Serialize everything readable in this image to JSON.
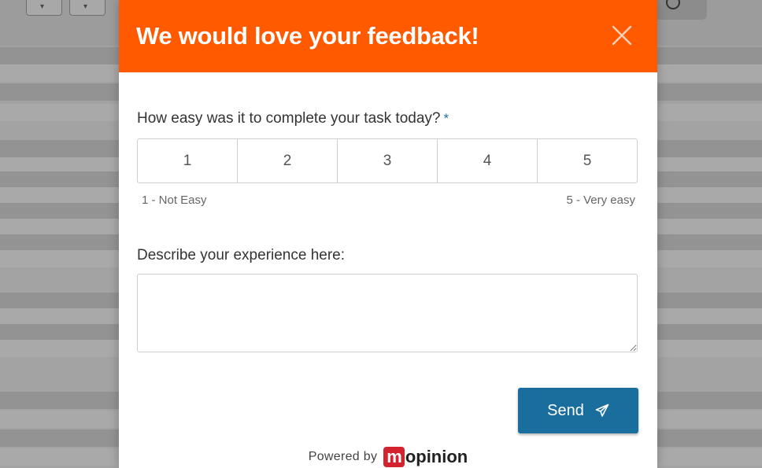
{
  "modal": {
    "title": "We would love your feedback!",
    "close_icon": "close-icon",
    "question": "How easy was it to complete your task today?",
    "required_marker": "*",
    "rating_options": [
      "1",
      "2",
      "3",
      "4",
      "5"
    ],
    "scale_low_label": "1 - Not Easy",
    "scale_high_label": "5 - Very easy",
    "experience_label": "Describe your experience here:",
    "experience_value": "",
    "send_label": "Send",
    "send_icon": "paper-plane-icon",
    "powered_by": "Powered by",
    "brand_mark": "m",
    "brand_rest": "opinion"
  },
  "colors": {
    "header": "#ff5a00",
    "send_button": "#1a6e9e",
    "brand_red": "#d3232f"
  }
}
